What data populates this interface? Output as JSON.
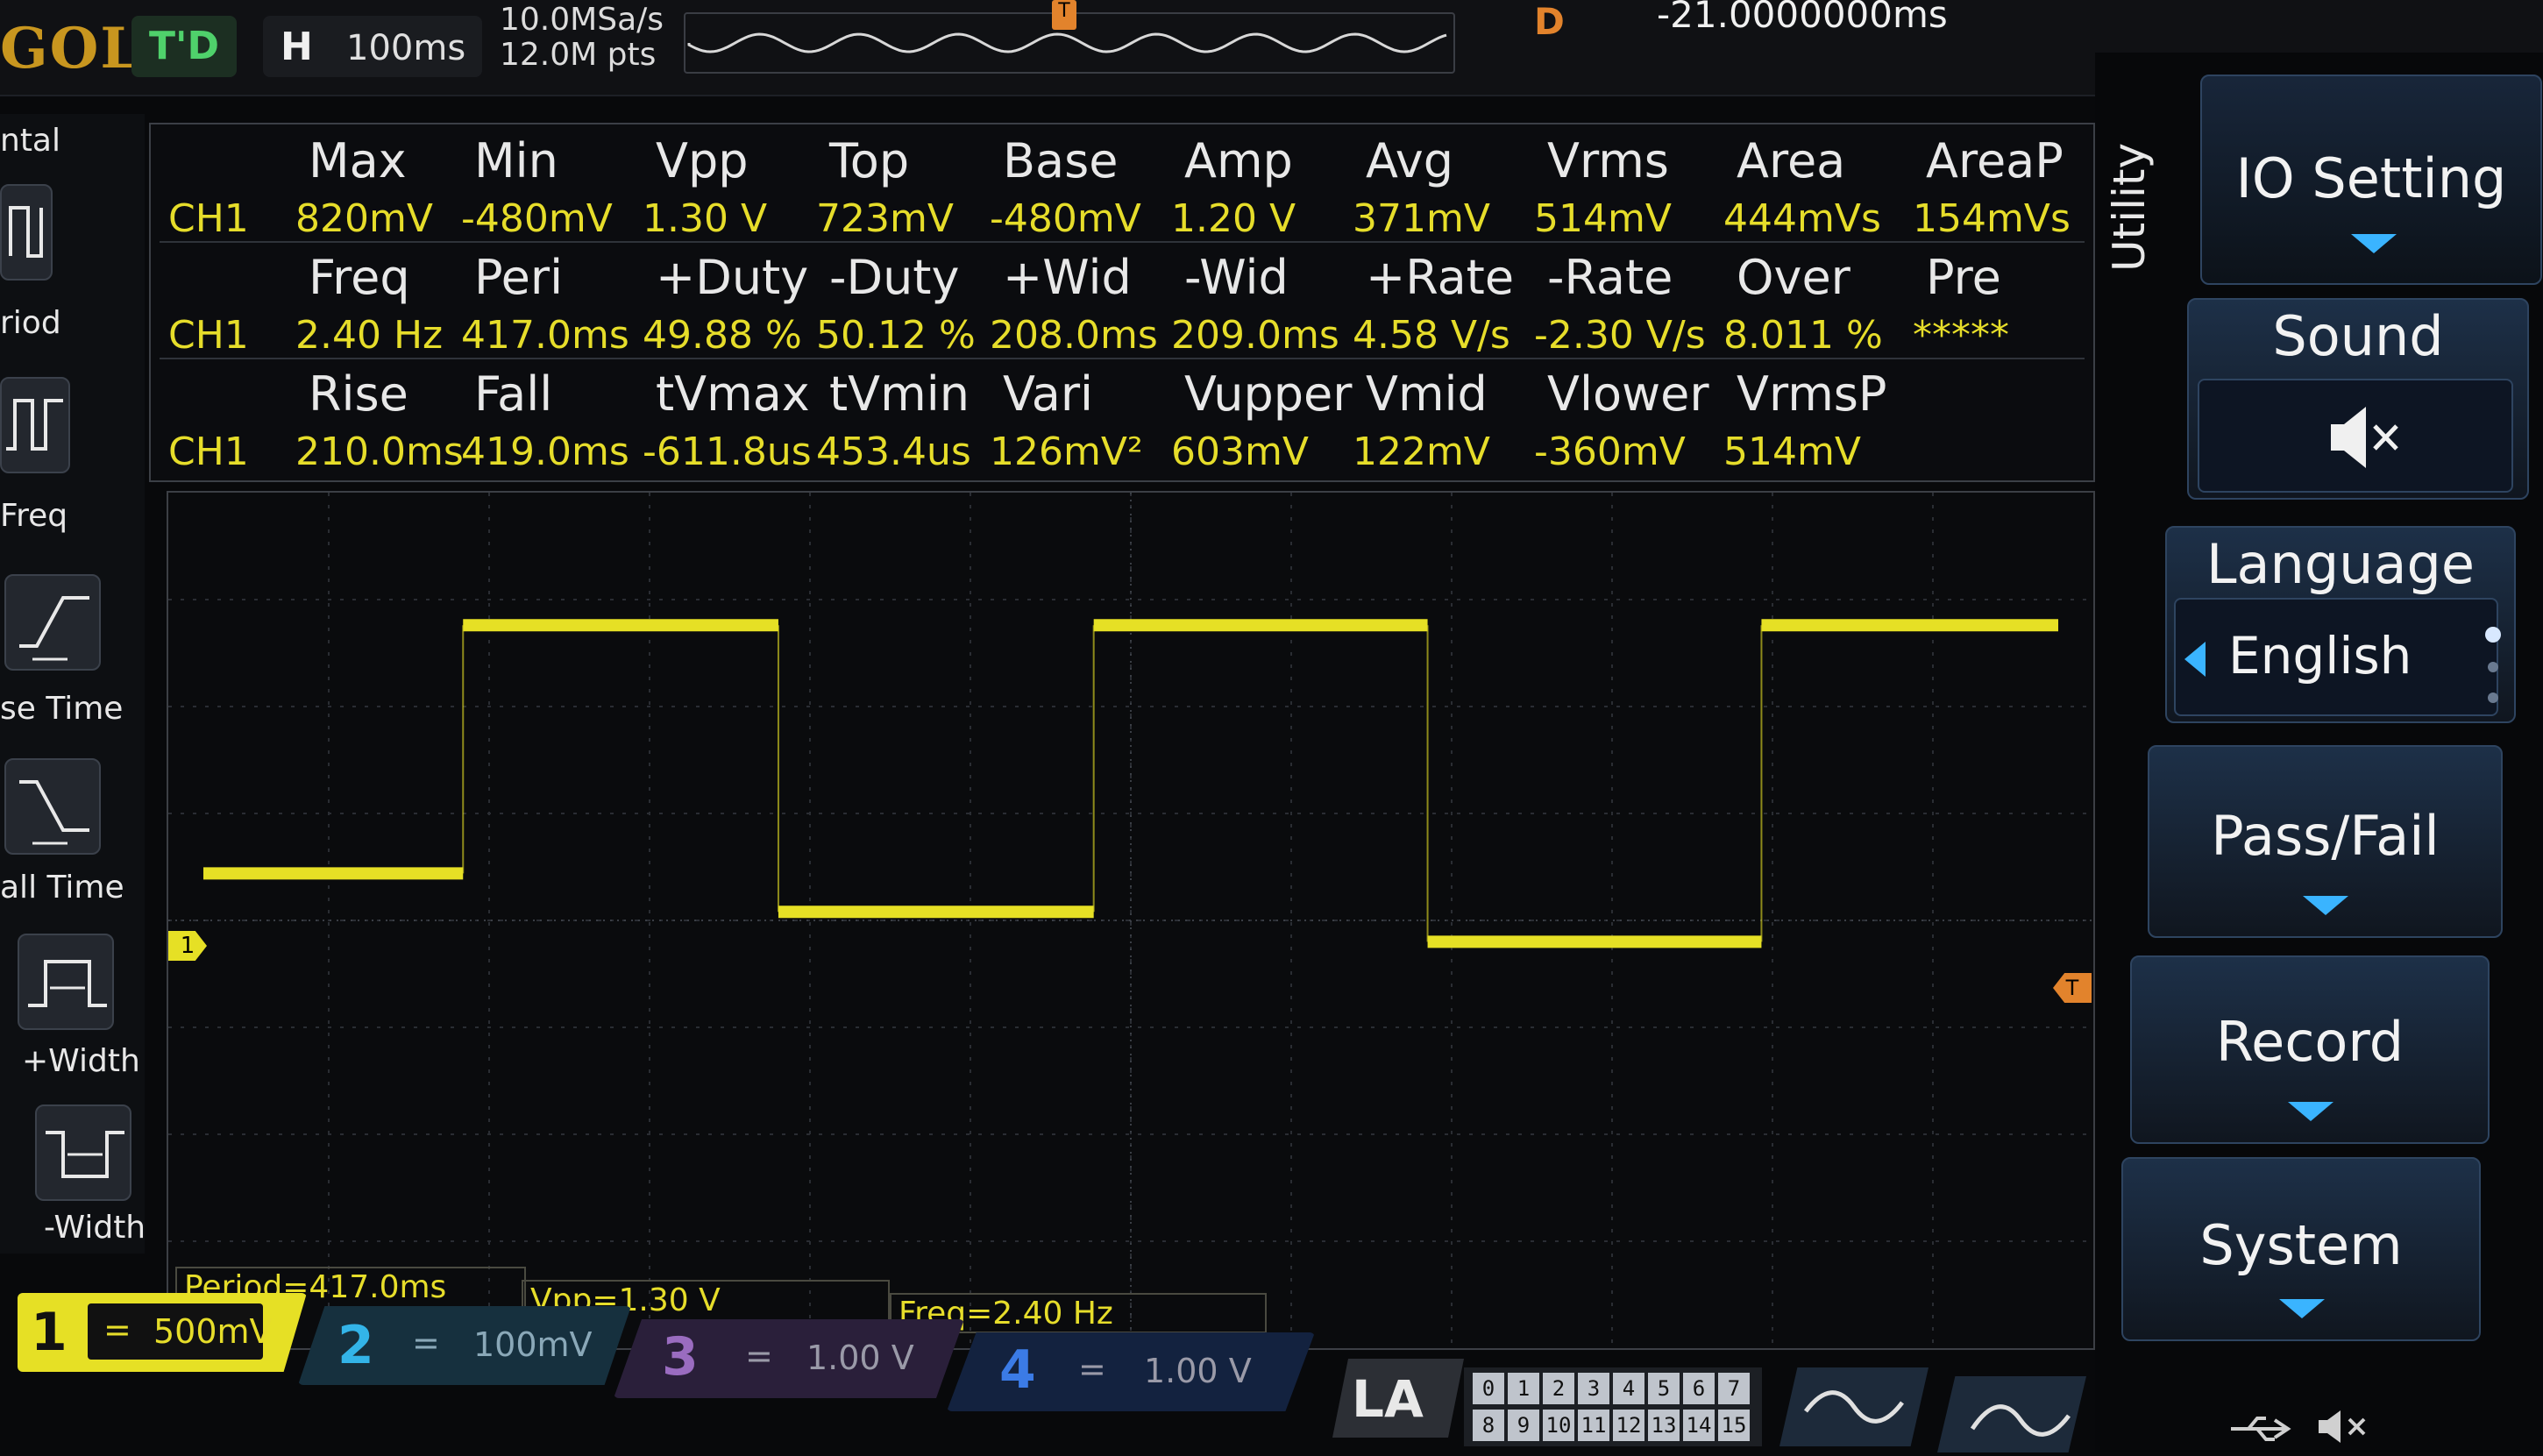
{
  "topbar": {
    "brand": "GOL",
    "trig_state": "T'D",
    "timebase_label": "H",
    "timebase_value": "100ms",
    "sample_rate": "10.0MSa/s",
    "mem_depth": "12.0M pts",
    "delay_label": "D",
    "delay_value": "-21.0000000ms"
  },
  "left_strip": {
    "items": [
      {
        "label": "ntal",
        "icon": "horizontal-icon"
      },
      {
        "label": "riod",
        "icon": "period-icon"
      },
      {
        "label": "Freq",
        "icon": "frequency-icon"
      },
      {
        "label": "se Time",
        "icon": "rise-time-icon"
      },
      {
        "label": "all Time",
        "icon": "fall-time-icon"
      },
      {
        "label": "+Width",
        "icon": "positive-width-icon"
      },
      {
        "label": "-Width",
        "icon": "negative-width-icon"
      }
    ]
  },
  "measurements": {
    "channel": "CH1",
    "row1": {
      "headers": [
        "Max",
        "Min",
        "Vpp",
        "Top",
        "Base",
        "Amp",
        "Avg",
        "Vrms",
        "Area",
        "AreaP"
      ],
      "values": [
        "820mV",
        "-480mV",
        "1.30 V",
        "723mV",
        "-480mV",
        "1.20 V",
        "371mV",
        "514mV",
        "444mVs",
        "154mVs"
      ]
    },
    "row2": {
      "headers": [
        "Freq",
        "Peri",
        "+Duty",
        "-Duty",
        "+Wid",
        "-Wid",
        "+Rate",
        "-Rate",
        "Over",
        "Pre"
      ],
      "values": [
        "2.40 Hz",
        "417.0ms",
        "49.88 %",
        "50.12 %",
        "208.0ms",
        "209.0ms",
        "4.58 V/s",
        "-2.30 V/s",
        "8.011 %",
        "*****"
      ]
    },
    "row3": {
      "headers": [
        "Rise",
        "Fall",
        "tVmax",
        "tVmin",
        "Vari",
        "Vupper",
        "Vmid",
        "Vlower",
        "VrmsP"
      ],
      "values": [
        "210.0ms",
        "419.0ms",
        "-611.8us",
        "453.4us",
        "126mV²",
        "603mV",
        "122mV",
        "-360mV",
        "514mV"
      ]
    }
  },
  "waveform": {
    "channel_marker": "1",
    "trigger_marker": "T",
    "color": "#e6e025",
    "segments": [
      {
        "level": "low",
        "t_start": 0.0,
        "t_end": 0.14
      },
      {
        "level": "high",
        "t_start": 0.14,
        "t_end": 0.31
      },
      {
        "level": "mid",
        "t_start": 0.31,
        "t_end": 0.48
      },
      {
        "level": "high",
        "t_start": 0.48,
        "t_end": 0.66
      },
      {
        "level": "lowmid",
        "t_start": 0.66,
        "t_end": 0.84
      },
      {
        "level": "high",
        "t_start": 0.84,
        "t_end": 1.0
      }
    ]
  },
  "right_panel": {
    "title": "Utility",
    "menus": [
      {
        "label": "IO Setting",
        "type": "submenu"
      },
      {
        "label": "Sound",
        "type": "icon",
        "icon": "speaker-muted-icon"
      },
      {
        "label": "Language",
        "value": "English",
        "type": "select"
      },
      {
        "label": "Pass/Fail",
        "type": "submenu"
      },
      {
        "label": "Record",
        "type": "submenu"
      },
      {
        "label": "System",
        "type": "submenu"
      }
    ]
  },
  "bottom": {
    "info": {
      "period": "Period=417.0ms",
      "vpp": "Vpp=1.30 V",
      "freq": "Freq=2.40 Hz"
    },
    "channels": [
      {
        "num": "1",
        "coupling": "=",
        "scale": "500mV",
        "color": "#e6e025"
      },
      {
        "num": "2",
        "coupling": "=",
        "scale": "100mV",
        "color": "#33b4e8"
      },
      {
        "num": "3",
        "coupling": "=",
        "scale": "1.00 V",
        "color": "#b25bd6"
      },
      {
        "num": "4",
        "coupling": "=",
        "scale": "1.00 V",
        "color": "#3b7be6"
      }
    ],
    "la_label": "LA",
    "digital_row1": [
      "0",
      "1",
      "2",
      "3",
      "4",
      "5",
      "6",
      "7"
    ],
    "digital_row2": [
      "8",
      "9",
      "10",
      "11",
      "12",
      "13",
      "14",
      "15"
    ]
  },
  "colors": {
    "ch1": "#e6e025",
    "accent_orange": "#e2832c",
    "menu_blue": "#1d3048",
    "arrow_blue": "#3ab4ff"
  }
}
